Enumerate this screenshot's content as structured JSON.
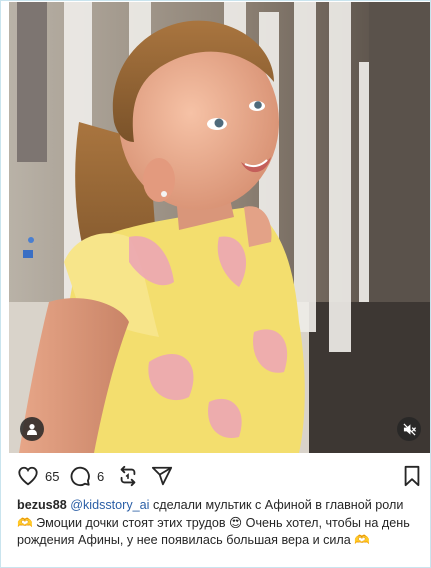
{
  "post": {
    "likes": "65",
    "comments": "6",
    "caption": {
      "username": "bezus88",
      "mention": "@kidsstory_ai",
      "text": "сделали мультик с Афиной в главной роли 🫶 Эмоции дочки стоят этих трудов 😍 Очень хотел, чтобы на день рождения Афины, у нее появилась большая вера и сила 🫶"
    }
  },
  "icons": {
    "user_tag": "person-icon",
    "mute": "speaker-muted-icon",
    "like": "heart-icon",
    "comment": "comment-bubble-icon",
    "share": "repost-icon",
    "send": "paper-plane-icon",
    "save": "bookmark-icon"
  },
  "colors": {
    "mention": "#2b5fa6",
    "dress": "#f3de6e",
    "border": "#c9e4ee"
  }
}
